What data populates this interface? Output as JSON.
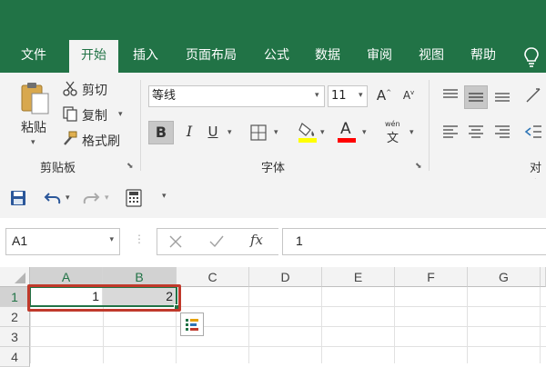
{
  "tabs": [
    {
      "label": "文件"
    },
    {
      "label": "开始"
    },
    {
      "label": "插入"
    },
    {
      "label": "页面布局"
    },
    {
      "label": "公式"
    },
    {
      "label": "数据"
    },
    {
      "label": "审阅"
    },
    {
      "label": "视图"
    },
    {
      "label": "帮助"
    }
  ],
  "ribbon": {
    "clipboard": {
      "paste_label": "粘贴",
      "cut_label": "剪切",
      "copy_label": "复制",
      "format_painter_label": "格式刷",
      "group_label": "剪贴板"
    },
    "font": {
      "font_name": "等线",
      "font_size": "11",
      "bold": "B",
      "italic": "I",
      "underline": "U",
      "font_color_letter": "A",
      "phonetic_glyph": "文",
      "phonetic_top": "wén",
      "group_label": "字体"
    },
    "alignment": {
      "group_label": "对齐"
    }
  },
  "formula_bar": {
    "name_box": "A1",
    "fx_label": "fx",
    "value": "1"
  },
  "sheet": {
    "columns": [
      "A",
      "B",
      "C",
      "D",
      "E",
      "F",
      "G"
    ],
    "rows": [
      "1",
      "2",
      "3",
      "4"
    ],
    "cells": {
      "A1": "1",
      "B1": "2"
    }
  },
  "colors": {
    "accent": "#217346",
    "highlight_red": "#c0392b",
    "fill_yellow": "#ffff00",
    "font_red": "#ff0000"
  }
}
